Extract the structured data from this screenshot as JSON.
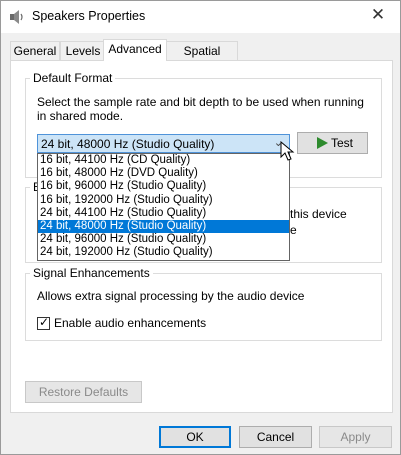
{
  "window": {
    "title": "Speakers Properties",
    "close_glyph": "✕"
  },
  "tabs": [
    {
      "label": "General"
    },
    {
      "label": "Levels"
    },
    {
      "label": "Advanced",
      "active": true
    },
    {
      "label": "Spatial sound"
    }
  ],
  "default_format": {
    "group_title": "Default Format",
    "description_line1": "Select the sample rate and bit depth to be used when running",
    "description_line2": "in shared mode.",
    "selected_value": "24 bit, 48000 Hz (Studio Quality)",
    "test_label": "Test",
    "options": [
      "16 bit, 44100 Hz (CD Quality)",
      "16 bit, 48000 Hz (DVD Quality)",
      "16 bit, 96000 Hz (Studio Quality)",
      "16 bit, 192000 Hz (Studio Quality)",
      "24 bit, 44100 Hz (Studio Quality)",
      "24 bit, 48000 Hz (Studio Quality)",
      "24 bit, 96000 Hz (Studio Quality)",
      "24 bit, 192000 Hz (Studio Quality)"
    ],
    "selected_index": 5
  },
  "exclusive_mode": {
    "title_fragment": "E",
    "text_fragment1": "this device",
    "text_fragment2": "e"
  },
  "signal_enhancements": {
    "group_title": "Signal Enhancements",
    "description": "Allows extra signal processing by the audio device",
    "checkbox_label": "Enable audio enhancements",
    "checked": true
  },
  "restore_defaults_label": "Restore Defaults",
  "footer": {
    "ok_label": "OK",
    "cancel_label": "Cancel",
    "apply_label": "Apply"
  },
  "colors": {
    "accent": "#0078d7",
    "test_icon": "#2e8b2e"
  },
  "icons": {
    "window_icon": "speaker-icon",
    "test_icon": "play-icon",
    "combo_arrow": "chevron-down-icon"
  }
}
